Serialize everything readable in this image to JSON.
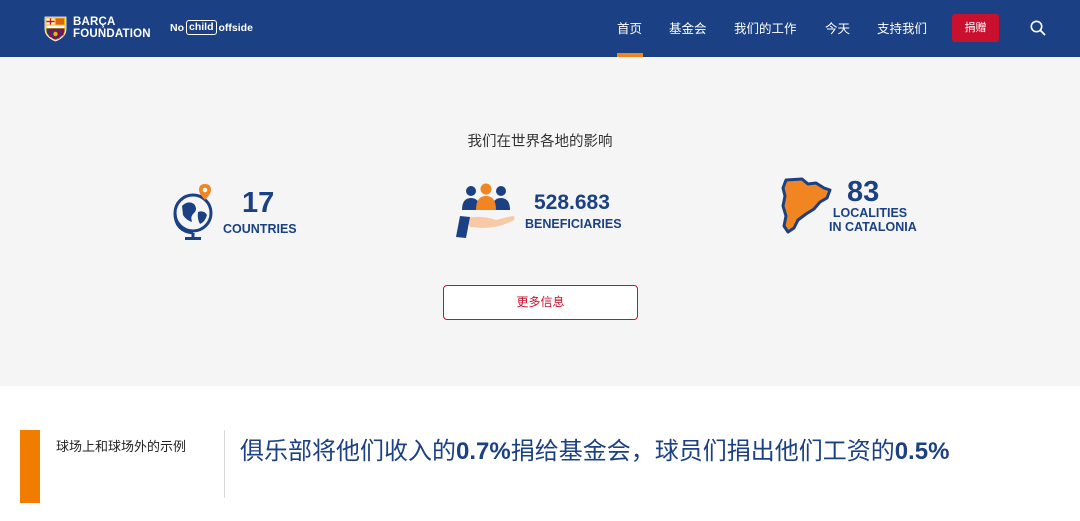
{
  "header": {
    "logo_lines": [
      "BARÇA",
      "FOUNDATION"
    ],
    "campaign": {
      "pre": "No",
      "boxed": "child",
      "post": "offside"
    },
    "nav": [
      {
        "label": "首页",
        "active": true
      },
      {
        "label": "基金会",
        "active": false
      },
      {
        "label": "我们的工作",
        "active": false
      },
      {
        "label": "今天",
        "active": false
      },
      {
        "label": "支持我们",
        "active": false
      }
    ],
    "donate_label": "捐赠",
    "search_icon": "search-icon"
  },
  "impact": {
    "title": "我们在世界各地的影响",
    "stats": [
      {
        "icon": "globe-pin-icon",
        "value": "17",
        "label_lines": [
          "COUNTRIES"
        ]
      },
      {
        "icon": "people-hand-icon",
        "value": "528.683",
        "label_lines": [
          "BENEFICIARIES"
        ]
      },
      {
        "icon": "catalonia-map-icon",
        "value": "83",
        "label_lines": [
          "LOCALITIES",
          "IN CATALONIA"
        ]
      }
    ],
    "more_label": "更多信息"
  },
  "bottom": {
    "side_label": "球场上和球场外的示例",
    "headline": {
      "part1": "俱乐部将他们收入的",
      "pct1": "0.7%",
      "part2": "捐给基金会，球员们捐出他们工资的",
      "pct2": "0.5%"
    }
  },
  "colors": {
    "brand_blue": "#1b4083",
    "accent_orange": "#f08522",
    "donate_red": "#c9102f",
    "section_bg": "#f5f5f5"
  }
}
